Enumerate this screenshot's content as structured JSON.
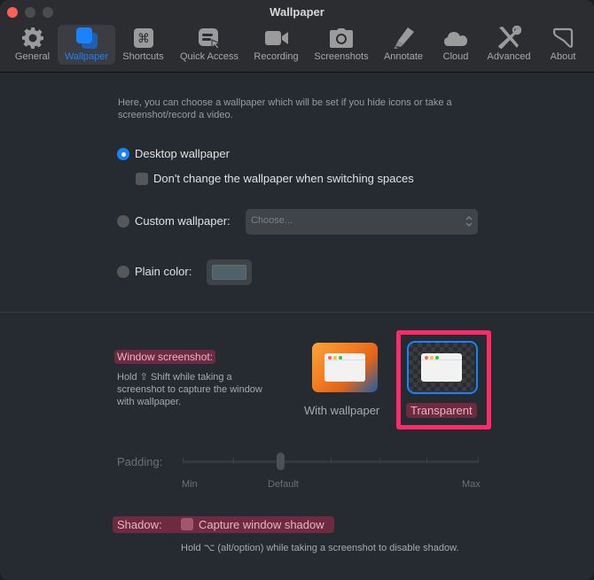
{
  "window": {
    "title": "Wallpaper",
    "accent_color": "#1a82ff",
    "highlight_color": "#6e2a3e",
    "annotation_color": "#ff2a68"
  },
  "toolbar": {
    "items": [
      {
        "label": "General",
        "icon": "gear-icon",
        "active": false
      },
      {
        "label": "Wallpaper",
        "icon": "wallpaper-icon",
        "active": true
      },
      {
        "label": "Shortcuts",
        "icon": "command-key-icon",
        "active": false
      },
      {
        "label": "Quick Access",
        "icon": "quick-access-icon",
        "active": false
      },
      {
        "label": "Recording",
        "icon": "video-camera-icon",
        "active": false
      },
      {
        "label": "Screenshots",
        "icon": "camera-icon",
        "active": false
      },
      {
        "label": "Annotate",
        "icon": "highlighter-icon",
        "active": false
      },
      {
        "label": "Cloud",
        "icon": "cloud-icon",
        "active": false
      },
      {
        "label": "Advanced",
        "icon": "tools-icon",
        "active": false
      },
      {
        "label": "About",
        "icon": "about-icon",
        "active": false
      }
    ]
  },
  "wallpaper": {
    "intro": "Here, you can choose a wallpaper which will be set if you hide icons or take a screenshot/record a video.",
    "desktop_wallpaper": {
      "label": "Desktop wallpaper",
      "selected": true
    },
    "dont_change": {
      "label": "Don't change the wallpaper when switching spaces",
      "checked": false
    },
    "custom_wallpaper": {
      "label": "Custom wallpaper:",
      "selected": false,
      "placeholder": "Choose..."
    },
    "plain_color": {
      "label": "Plain color:",
      "selected": false,
      "color": "#4f6169"
    }
  },
  "window_screenshot": {
    "label": "Window screenshot:",
    "help": "Hold ⇧ Shift while taking a screenshot to capture the window with wallpaper.",
    "options": [
      {
        "label": "With wallpaper",
        "selected": false
      },
      {
        "label": "Transparent",
        "selected": true
      }
    ]
  },
  "padding": {
    "label": "Padding:",
    "min_label": "Min",
    "default_label": "Default",
    "max_label": "Max",
    "value_fraction": 0.33
  },
  "shadow": {
    "label": "Shadow:",
    "checkbox_label": "Capture window shadow",
    "checked": false,
    "help": "Hold ⌥ (alt/option) while taking a screenshot to disable shadow."
  }
}
